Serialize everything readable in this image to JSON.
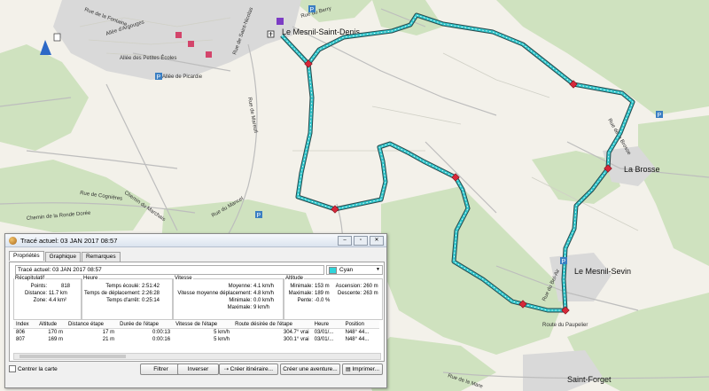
{
  "map": {
    "place_labels": {
      "mesnil_saint_denis": "Le Mesnil-Saint-Denis",
      "la_brosse": "La Brosse",
      "mesnil_sevin": "Le Mesnil-Sevin",
      "saint_forget": "Saint-Forget"
    },
    "street_labels": {
      "allee_petites_ecoles": "Allée des Petites Écoles",
      "rue_mareuil": "Rue de Mareuil",
      "chemin_ronde": "Chemin de la Ronde Dorée",
      "rue_cognieres": "Rue de Cognières",
      "chemin_marchais": "Chemin du Marchais",
      "rue_mare": "Rue de la Mare",
      "route_paupelier": "Route du Paupelier",
      "allee_picardie": "Allée de Picardie",
      "rue_brosse": "Rue de la Brosse",
      "allee_argouges": "Allée d'Argouges",
      "cyrus_fontaine": "Rue de la Fontaine",
      "rue_saint_nicolas": "Rue de Saint-Nicolas",
      "rue_bel_air": "Rue du Bel-Air",
      "rue_mancel": "Rue du Mancel",
      "rue_berry": "Rue du Berry"
    },
    "route_color": "#2fc6cc",
    "poi_icons": [
      "parking-icon",
      "mountain-icon",
      "hotel-icon",
      "church-icon"
    ]
  },
  "dialog": {
    "title": "Tracé actuel: 03 JAN 2017 08:57",
    "tabs": [
      "Propriétés",
      "Graphique",
      "Remarques"
    ],
    "track_name": "Tracé actuel: 03 JAN 2017 08:57",
    "color_name": "Cyan",
    "color_hex": "#2fd4da",
    "summary": {
      "title": "Récapitulatif",
      "points_label": "Points:",
      "points": "818",
      "distance_label": "Distance:",
      "distance": "11.7 km",
      "zone_label": "Zone:",
      "zone": "4.4 km²"
    },
    "time": {
      "title": "Heure",
      "elapsed_label": "Temps écoulé:",
      "elapsed": "2:51:42",
      "moving_label": "Temps de déplacement:",
      "moving": "2:26:28",
      "stopped_label": "Temps d'arrêt:",
      "stopped": "0:25:14"
    },
    "speed": {
      "title": "Vitesse",
      "avg_label": "Moyenne:",
      "avg": "4.1 km/h",
      "moving_avg_label": "Vitesse moyenne déplacement:",
      "moving_avg": "4.8 km/h",
      "min_label": "Minimale:",
      "min": "0.0 km/h",
      "max_label": "Maximale:",
      "max": "9 km/h"
    },
    "altitude": {
      "title": "Altitude",
      "min_label": "Minimale:",
      "min": "153 m",
      "max_label": "Maximale:",
      "max": "189 m",
      "slope_label": "Pente:",
      "slope": "-0.0 %",
      "ascent_label": "Ascension:",
      "ascent": "260 m",
      "descent_label": "Descente:",
      "descent": "263 m"
    },
    "table": {
      "headers": [
        "Index",
        "Altitude",
        "Distance étape",
        "Durée de l'étape",
        "Vitesse de l'étape",
        "Route désirée de l'étape",
        "Heure",
        "Position"
      ],
      "rows": [
        [
          "806",
          "170 m",
          "17 m",
          "0:00:13",
          "5 km/h",
          "304.7° vrai",
          "03/01/...",
          "N48° 44..."
        ],
        [
          "807",
          "169 m",
          "21 m",
          "0:00:16",
          "5 km/h",
          "300.1° vrai",
          "03/01/...",
          "N48° 44..."
        ]
      ]
    },
    "center_map_label": "Centrer la carte",
    "buttons": {
      "filter": "Filtrer",
      "invert": "Inverser",
      "create_route": "Créer itinéraire...",
      "create_adventure": "Créer une aventure...",
      "print": "Imprimer..."
    }
  }
}
